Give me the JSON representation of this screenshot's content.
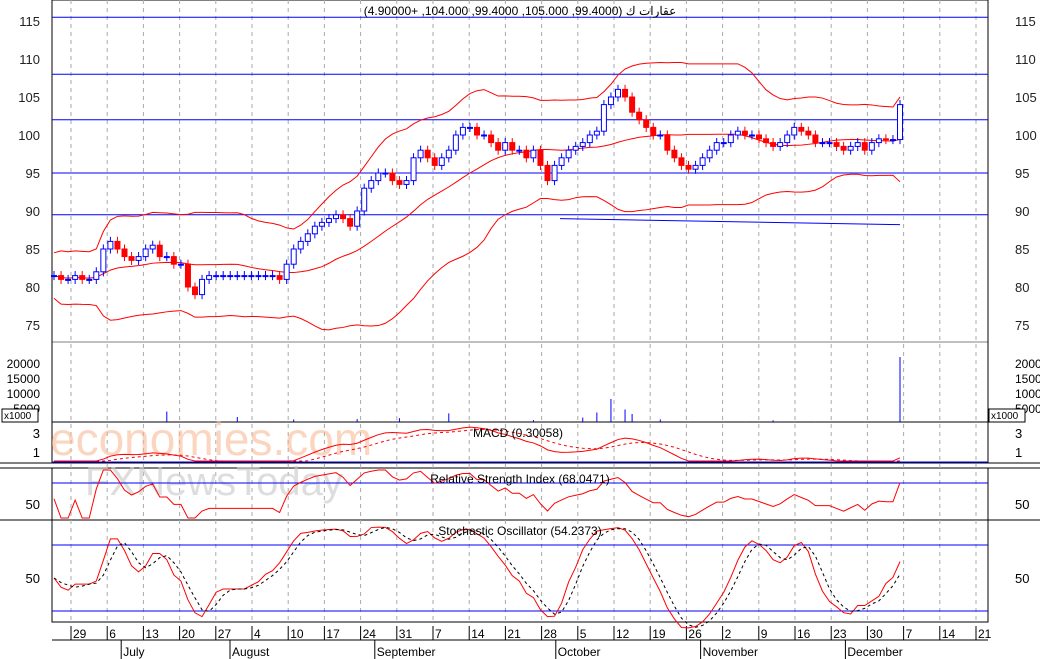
{
  "title": "عقارات ك (99.4000, 105.000, 99.4000, 104.000, +4.90000)",
  "watermark": {
    "line1": "economies.com",
    "line2": "FXNewsToday"
  },
  "colors": {
    "up": "#0000ff",
    "down": "#ff0000",
    "band": "#ff0000",
    "hline": "#0000ff",
    "macd": "#ff0000",
    "signal": "#ff0000",
    "stoch_d": "#000000"
  },
  "chart_data": {
    "type": "candlestick",
    "title": "عقارات ك (99.4000, 105.000, 99.4000, 104.000, +4.90000)",
    "price_axis": {
      "ylim": [
        72,
        116
      ],
      "ticks": [
        75,
        80,
        85,
        90,
        95,
        100,
        105,
        110,
        115
      ]
    },
    "horizontal_lines": [
      115.5,
      108,
      102,
      95,
      89.5
    ],
    "trendline": [
      89,
      88.2
    ],
    "closes": [
      81.5,
      81,
      81,
      81.5,
      81,
      81,
      82,
      85,
      86,
      85,
      84,
      83.5,
      84,
      85,
      85.5,
      84,
      84,
      83,
      83,
      80,
      79,
      81,
      81.5,
      81.5,
      81.5,
      81.5,
      81.5,
      81.5,
      81.5,
      81.5,
      81.5,
      81.5,
      81,
      83,
      85,
      86,
      87,
      88,
      88.5,
      89,
      89.5,
      89,
      88,
      90,
      93,
      94,
      95,
      95,
      94,
      93.5,
      94,
      97,
      98,
      97,
      96,
      97,
      98,
      100,
      101,
      101,
      100,
      100,
      99,
      98,
      99,
      98,
      98,
      97,
      98,
      96,
      94,
      96,
      97,
      98,
      98.5,
      99,
      100,
      100.5,
      104,
      105,
      106,
      105,
      103,
      102,
      101,
      100,
      100,
      98,
      97,
      96,
      95.5,
      96,
      97,
      98,
      99,
      99,
      100,
      100.5,
      100,
      100,
      99.5,
      99,
      98.5,
      99,
      100,
      101,
      100.5,
      100,
      99,
      99,
      99,
      98.5,
      98,
      98.5,
      99,
      98,
      99,
      99.5,
      99.4,
      99.4,
      104
    ],
    "volume": {
      "unit": "x1000",
      "label": "x1000",
      "ticks": [
        5000,
        10000,
        15000,
        20000
      ],
      "spikes": {
        "16": 3800,
        "26": 2000,
        "34": 1200,
        "43": 1300,
        "49": 1600,
        "56": 3200,
        "68": 1000,
        "75": 1800,
        "77": 3500,
        "79": 8000,
        "81": 4500,
        "82": 3000,
        "86": 1200,
        "102": 900,
        "120": 22000
      }
    },
    "indicators": [
      {
        "name": "MACD",
        "label": "MACD (0.30058)",
        "ticks": [
          1,
          3
        ]
      },
      {
        "name": "RSI",
        "label": "Relative Strength Index (68.0471)",
        "ticks": [
          50
        ]
      },
      {
        "name": "Stochastic",
        "label": "Stochastic Oscillator (54.2373)",
        "ticks": [
          50
        ]
      }
    ],
    "x_axis": {
      "day_ticks": [
        "29",
        "6",
        "13",
        "20",
        "27",
        "4",
        "10",
        "17",
        "24",
        "31",
        "7",
        "14",
        "21",
        "28",
        "5",
        "12",
        "19",
        "26",
        "2",
        "9",
        "16",
        "23",
        "30",
        "7",
        "14",
        "21"
      ],
      "months": [
        {
          "label": "July",
          "at": 1
        },
        {
          "label": "August",
          "at": 5
        },
        {
          "label": "September",
          "at": 9
        },
        {
          "label": "October",
          "at": 14
        },
        {
          "label": "November",
          "at": 18
        },
        {
          "label": "December",
          "at": 22
        }
      ]
    }
  }
}
